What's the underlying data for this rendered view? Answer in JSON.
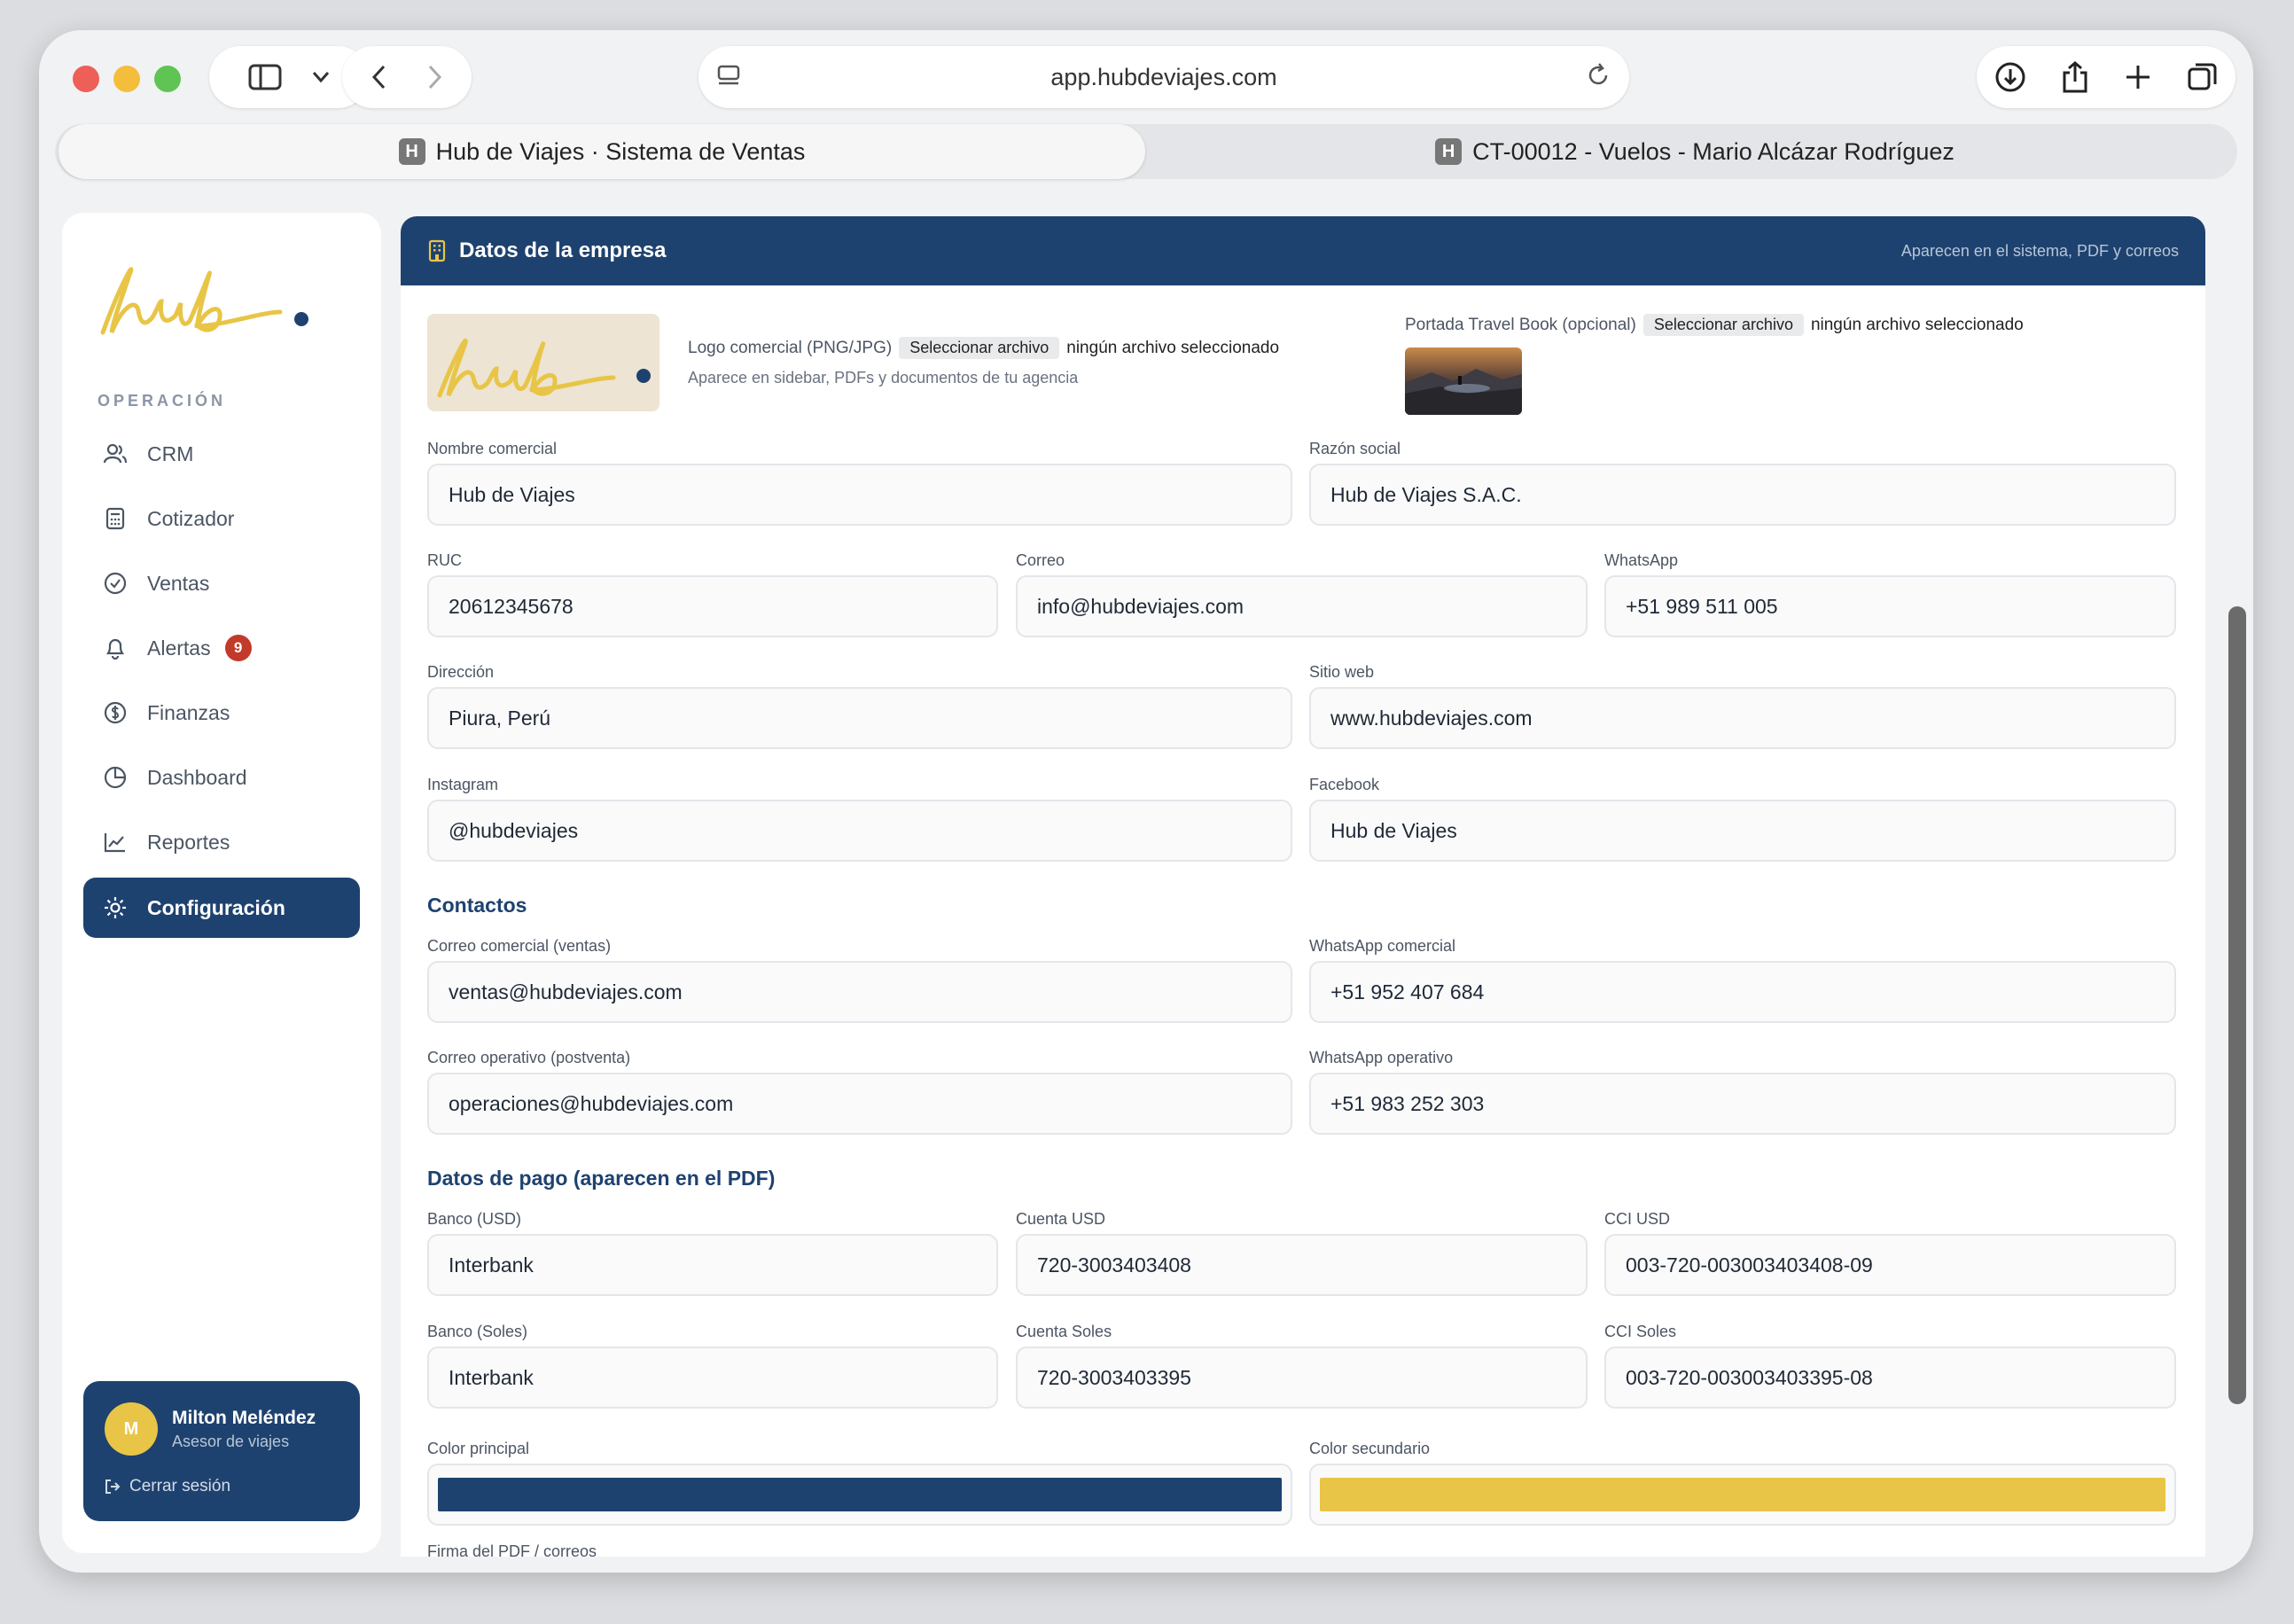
{
  "browser": {
    "url": "app.hubdeviajes.com",
    "tabs": [
      {
        "label": "Hub de Viajes · Sistema de Ventas",
        "favicon": "H"
      },
      {
        "label": "CT-00012 - Vuelos - Mario Alcázar Rodríguez",
        "favicon": "H"
      }
    ]
  },
  "sidebar": {
    "logo_text": "hub",
    "section": "OPERACIÓN",
    "items": [
      {
        "label": "CRM",
        "icon": "users-icon"
      },
      {
        "label": "Cotizador",
        "icon": "calculator-icon"
      },
      {
        "label": "Ventas",
        "icon": "check-circle-icon"
      },
      {
        "label": "Alertas",
        "icon": "bell-icon",
        "badge": "9"
      },
      {
        "label": "Finanzas",
        "icon": "dollar-icon"
      },
      {
        "label": "Dashboard",
        "icon": "pie-chart-icon"
      },
      {
        "label": "Reportes",
        "icon": "line-chart-icon"
      },
      {
        "label": "Configuración",
        "icon": "gear-icon"
      }
    ],
    "user": {
      "initial": "M",
      "name": "Milton Meléndez",
      "role": "Asesor de viajes",
      "logout": "Cerrar sesión"
    }
  },
  "main": {
    "title": "Datos de la empresa",
    "subtitle": "Aparecen en el sistema, PDF y correos",
    "logo": {
      "label": "Logo comercial (PNG/JPG)",
      "button": "Seleccionar archivo",
      "status": "ningún archivo seleccionado",
      "hint": "Aparece en sidebar, PDFs y documentos de tu agencia"
    },
    "cover": {
      "label": "Portada Travel Book (opcional)",
      "button": "Seleccionar archivo",
      "status": "ningún archivo seleccionado"
    },
    "fields": {
      "nombre_label": "Nombre comercial",
      "nombre": "Hub de Viajes",
      "razon_label": "Razón social",
      "razon": "Hub de Viajes S.A.C.",
      "ruc_label": "RUC",
      "ruc": "20612345678",
      "correo_label": "Correo",
      "correo": "info@hubdeviajes.com",
      "whatsapp_label": "WhatsApp",
      "whatsapp": "+51 989 511 005",
      "direccion_label": "Dirección",
      "direccion": "Piura, Perú",
      "web_label": "Sitio web",
      "web": "www.hubdeviajes.com",
      "instagram_label": "Instagram",
      "instagram": "@hubdeviajes",
      "facebook_label": "Facebook",
      "facebook": "Hub de Viajes"
    },
    "contacts": {
      "heading": "Contactos",
      "correo_com_label": "Correo comercial (ventas)",
      "correo_com": "ventas@hubdeviajes.com",
      "wa_com_label": "WhatsApp comercial",
      "wa_com": "+51 952 407 684",
      "correo_op_label": "Correo operativo (postventa)",
      "correo_op": "operaciones@hubdeviajes.com",
      "wa_op_label": "WhatsApp operativo",
      "wa_op": "+51 983 252 303"
    },
    "payment": {
      "heading": "Datos de pago (aparecen en el PDF)",
      "banco_usd_label": "Banco (USD)",
      "banco_usd": "Interbank",
      "cuenta_usd_label": "Cuenta USD",
      "cuenta_usd": "720-3003403408",
      "cci_usd_label": "CCI USD",
      "cci_usd": "003-720-003003403408-09",
      "banco_sol_label": "Banco (Soles)",
      "banco_sol": "Interbank",
      "cuenta_sol_label": "Cuenta Soles",
      "cuenta_sol": "720-3003403395",
      "cci_sol_label": "CCI Soles",
      "cci_sol": "003-720-003003403395-08"
    },
    "colors": {
      "principal_label": "Color principal",
      "principal": "#1e426f",
      "secundario_label": "Color secundario",
      "secundario": "#e8c547"
    },
    "firma_label": "Firma del PDF / correos"
  }
}
